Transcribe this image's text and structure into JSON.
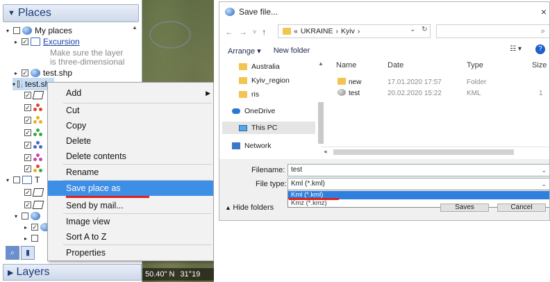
{
  "places": {
    "title": "Places",
    "tree": [
      {
        "label": "My places",
        "style": "normal"
      },
      {
        "label": "Excursion",
        "style": "link"
      },
      {
        "label": "Make sure the layer",
        "style": "muted"
      },
      {
        "label": "is three-dimensional",
        "style": "muted"
      },
      {
        "label": "test.shp",
        "style": "normal"
      },
      {
        "label": "test.shp",
        "style": "selected"
      },
      {
        "label": "T",
        "style": "normal"
      }
    ]
  },
  "context_menu": {
    "items": [
      {
        "label": "Add",
        "has_submenu": true
      },
      {
        "label": "Cut"
      },
      {
        "label": "Copy"
      },
      {
        "label": "Delete"
      },
      {
        "label": "Delete contents"
      },
      {
        "label": "Rename"
      },
      {
        "label": "Save place as"
      },
      {
        "label": "Send by mail..."
      },
      {
        "label": "Image view"
      },
      {
        "label": "Sort A to Z"
      },
      {
        "label": "Properties"
      }
    ]
  },
  "layers": {
    "title": "Layers"
  },
  "map_status": {
    "lat": "50.40\" N",
    "lon": "31°19"
  },
  "dialog": {
    "title": "Save file...",
    "close": "×",
    "nav": {
      "back": "←",
      "forward": "→",
      "recent": "˅",
      "up": "↑"
    },
    "path": {
      "prefix": "«",
      "parts": [
        "UKRAINE",
        "Kyiv"
      ],
      "sep": "›"
    },
    "search_icon": "⌕",
    "toolbar": {
      "arrange": "Arrange ▾",
      "new_folder": "New folder",
      "view": "☷ ▾",
      "help": "?"
    },
    "nav_pane": [
      "Australia",
      "Kyiv_region",
      "ris",
      "OneDrive",
      "This PC",
      "Network"
    ],
    "columns": [
      "Name",
      "Date",
      "Type",
      "Size"
    ],
    "files": [
      {
        "name": "new",
        "date": "17.01.2020 17:57",
        "type": "Folder",
        "size": ""
      },
      {
        "name": "test",
        "date": "20.02.2020 15:22",
        "type": "KML",
        "size": "1"
      }
    ],
    "filename_label": "Filename:",
    "filename_value": "test",
    "filetype_label": "File type:",
    "filetype_value": "Kml (*.kml)",
    "filetype_options": [
      "Kml (*.kml)",
      "Kmz (*.kmz)"
    ],
    "hide_folders": "Hide folders",
    "save_button": "Saves",
    "cancel_button": "Cancel"
  },
  "colors": {
    "accent": "#3d8ee6",
    "highlight_underline": "#e0201e"
  }
}
